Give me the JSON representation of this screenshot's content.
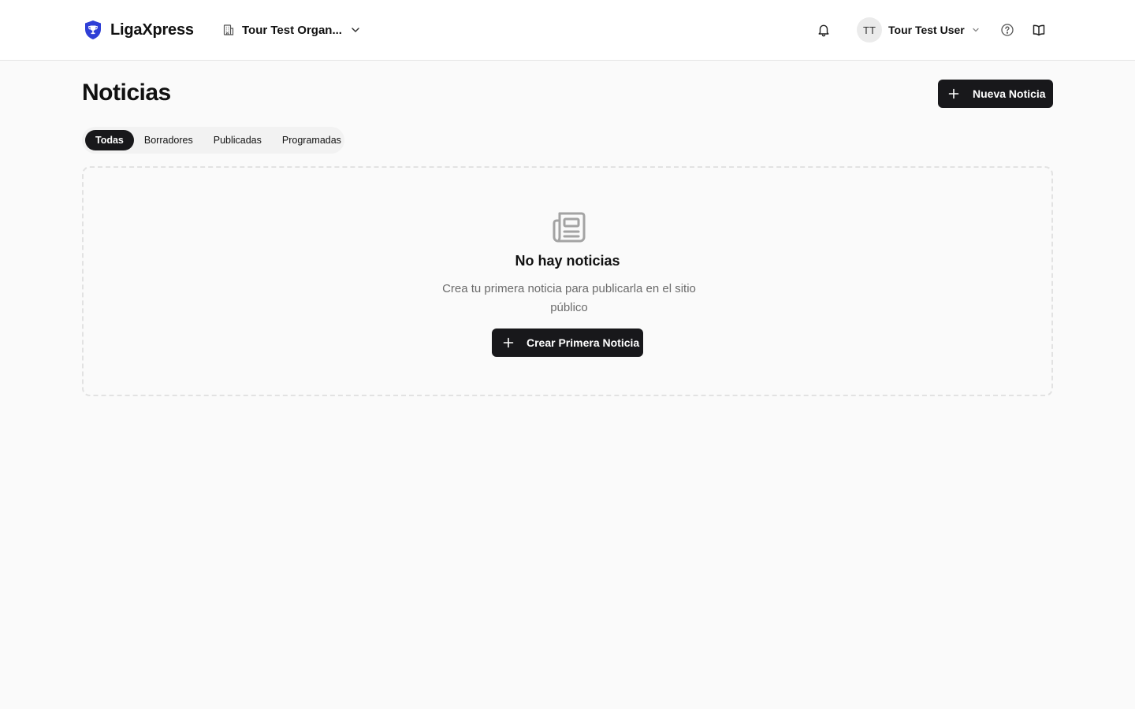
{
  "header": {
    "brand": "LigaXpress",
    "organization": "Tour Test Organ...",
    "user": {
      "initials": "TT",
      "name": "Tour Test User"
    },
    "icons": [
      "shield-trophy-icon",
      "building-icon",
      "chevron-down-icon",
      "bell-icon",
      "help-circle-icon",
      "book-open-icon"
    ]
  },
  "page": {
    "title": "Noticias",
    "new_button": "Nueva Noticia"
  },
  "tabs": [
    {
      "label": "Todas",
      "active": true
    },
    {
      "label": "Borradores",
      "active": false
    },
    {
      "label": "Publicadas",
      "active": false
    },
    {
      "label": "Programadas",
      "active": false
    }
  ],
  "empty_state": {
    "icon": "newspaper-icon",
    "title": "No hay noticias",
    "description": "Crea tu primera noticia para publicarla en el sitio público",
    "button": "Crear Primera Noticia"
  },
  "colors": {
    "background": "#fafafa",
    "brand_icon": "#2f3fd6",
    "button_dark": "#18181b",
    "muted_text": "#6b6b6b"
  }
}
